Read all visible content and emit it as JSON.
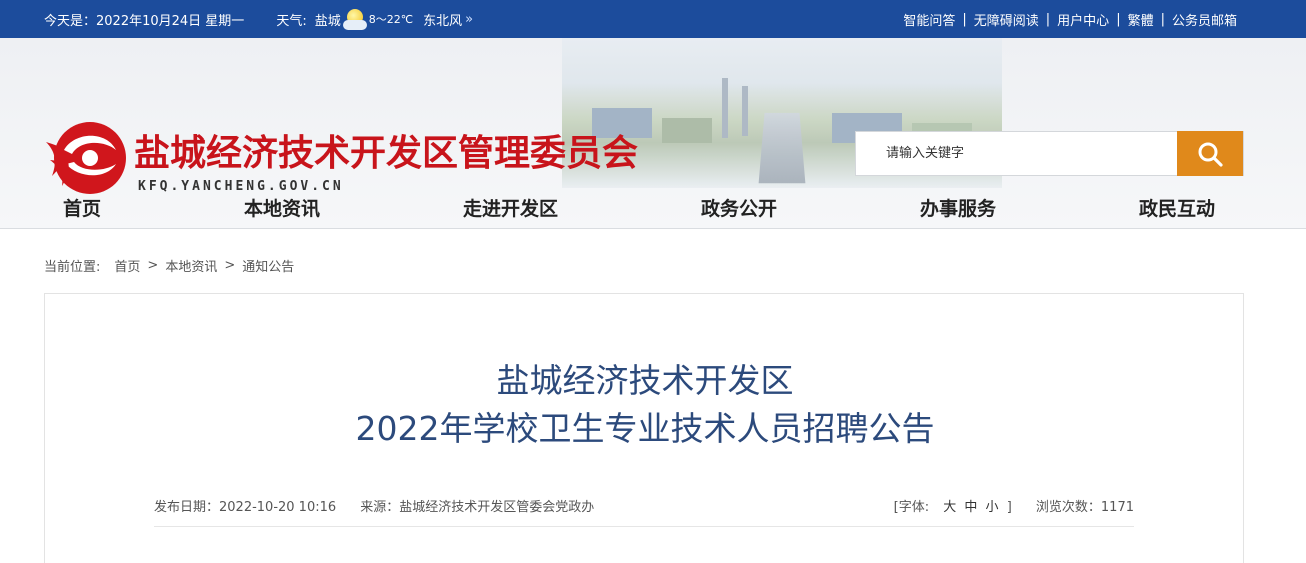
{
  "topbar": {
    "date": "今天是：2022年10月24日 星期一",
    "weather_label": "天气:",
    "city": "盐城",
    "temperature": "8～22℃",
    "wind": "东北风",
    "wind_arrow": "»",
    "links": [
      "智能问答",
      "无障碍阅读",
      "用户中心",
      "繁體",
      "公务员邮箱"
    ],
    "separator": "|"
  },
  "header": {
    "site_title": "盐城经济技术开发区管理委员会",
    "site_domain": "KFQ.YANCHENG.GOV.CN",
    "search_placeholder": "请输入关键字",
    "logo_color": "#d0161c",
    "search_button_color": "#e0891b"
  },
  "nav": {
    "items": [
      "首页",
      "本地资讯",
      "走进开发区",
      "政务公开",
      "办事服务",
      "政民互动"
    ]
  },
  "breadcrumb": {
    "label": "当前位置:",
    "items": [
      "首页",
      "本地资讯",
      "通知公告"
    ],
    "arrow": ">"
  },
  "article": {
    "title_line1": "盐城经济技术开发区",
    "title_line2": "2022年学校卫生专业技术人员招聘公告",
    "publish_label": "发布日期：2022-10-20 10:16",
    "source_label": "来源：盐城经济技术开发区管委会党政办",
    "font_label_open": "[字体:",
    "font_sizes": [
      "大",
      "中",
      "小"
    ],
    "font_label_close": "]",
    "views_label": "浏览次数：1171"
  },
  "colors": {
    "topbar_bg": "#1c4c9c",
    "title_red": "#c8141b",
    "article_title": "#2c4a7c"
  }
}
